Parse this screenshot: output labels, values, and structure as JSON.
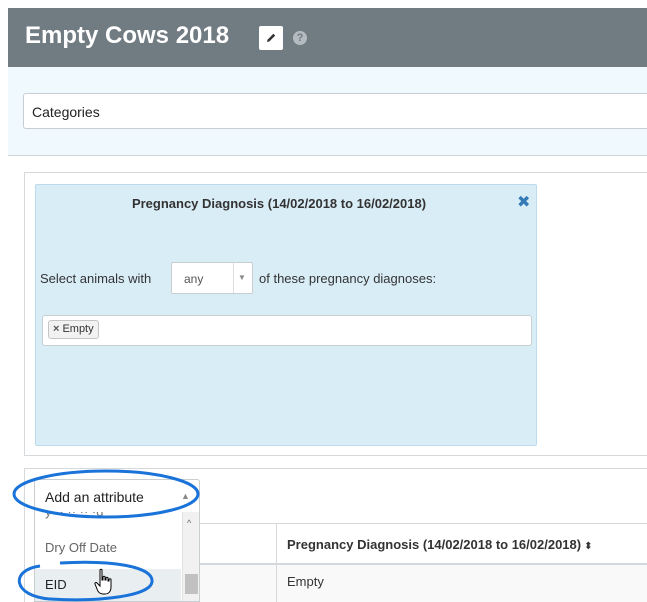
{
  "header": {
    "title": "Empty Cows 2018",
    "edit_icon": "pencil-icon",
    "help_icon": "question-circle-icon",
    "help_glyph": "?"
  },
  "categories": {
    "label": "Categories"
  },
  "filter": {
    "title": "Pregnancy Diagnosis (14/02/2018 to 16/02/2018)",
    "close_glyph": "✖",
    "prefix_text": "Select animals with",
    "match_value": "any",
    "suffix_text": "of these pregnancy diagnoses:",
    "tags": [
      {
        "label": "Empty",
        "remove_glyph": "×"
      }
    ]
  },
  "attribute_picker": {
    "label": "Add an attribute",
    "options": [
      {
        "label": "Dry Off Date"
      },
      {
        "label": "EID",
        "highlighted": true
      }
    ]
  },
  "table": {
    "columns": [
      {
        "label": "Pregnancy Diagnosis (14/02/2018 to 16/02/2018)",
        "sort_glyph": "⬍"
      }
    ],
    "rows": [
      [
        "Empty"
      ]
    ]
  },
  "colors": {
    "header_bg": "#717b82",
    "filter_card_bg": "#d9edf7",
    "close_icon": "#337ab7",
    "annotation_circle": "#1a73d9"
  }
}
